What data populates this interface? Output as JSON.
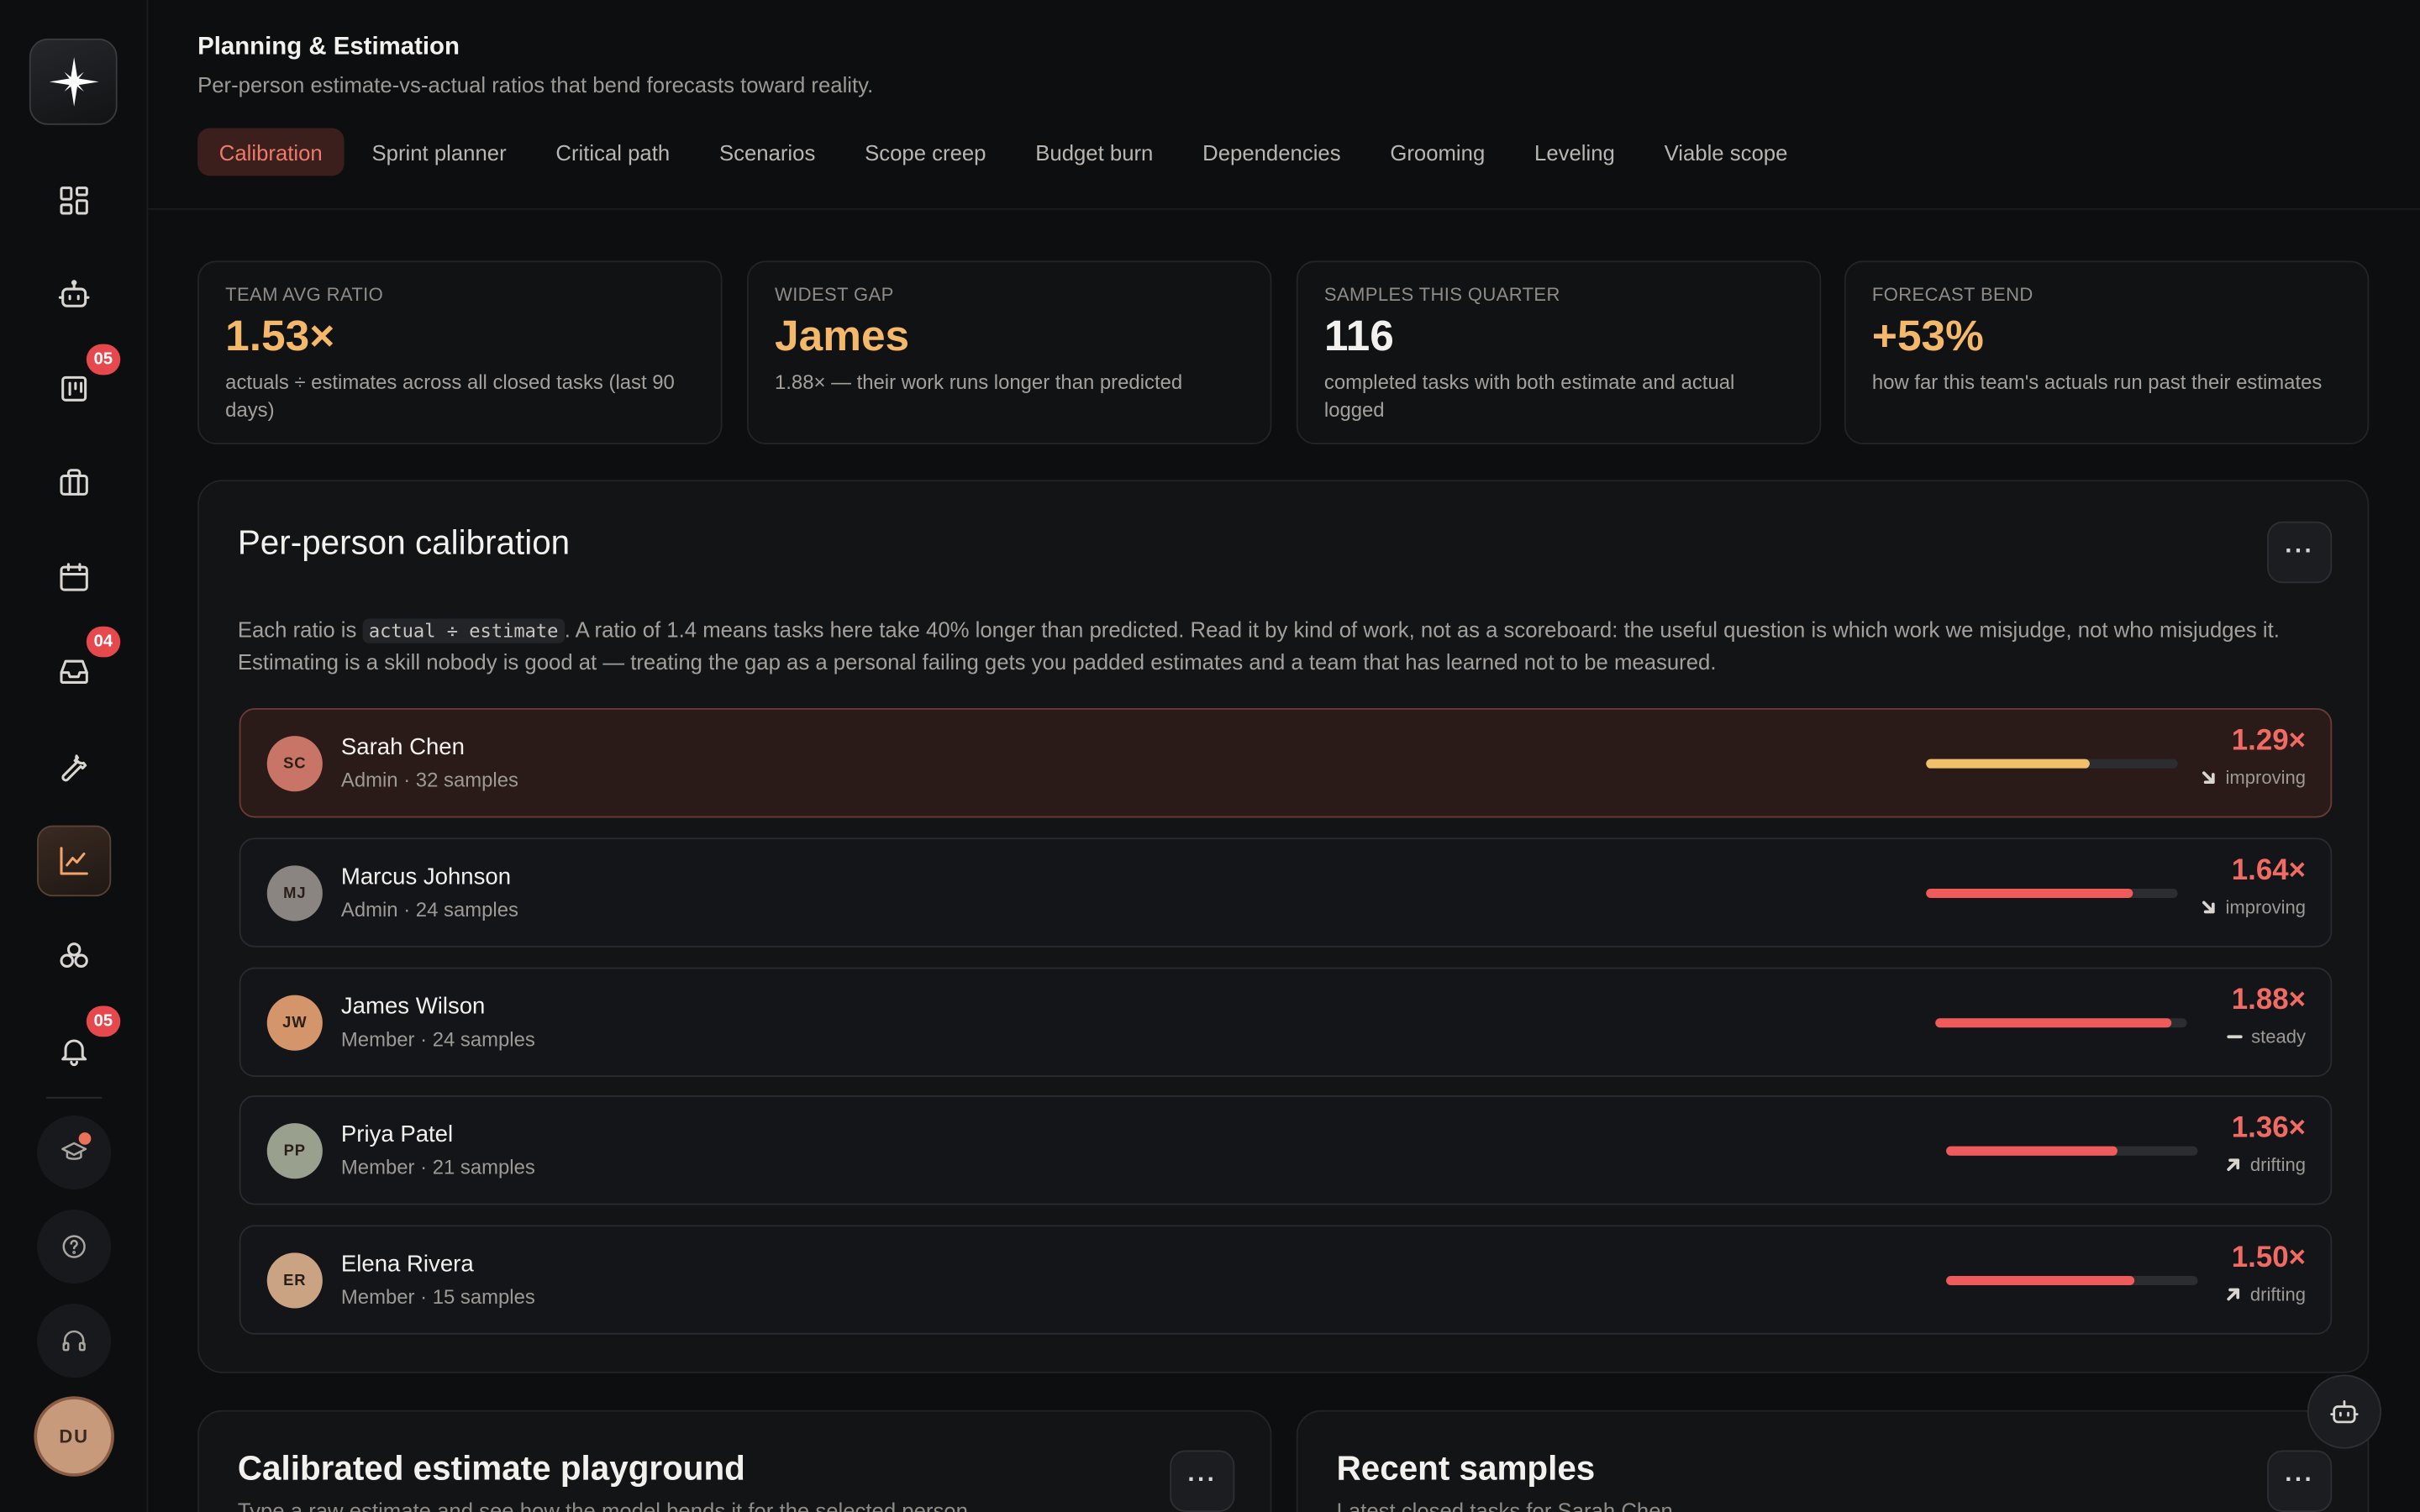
{
  "header": {
    "title": "Planning & Estimation",
    "subtitle": "Per-person estimate-vs-actual ratios that bend forecasts toward reality."
  },
  "tabs": [
    {
      "label": "Calibration",
      "active": true
    },
    {
      "label": "Sprint planner"
    },
    {
      "label": "Critical path"
    },
    {
      "label": "Scenarios"
    },
    {
      "label": "Scope creep"
    },
    {
      "label": "Budget burn"
    },
    {
      "label": "Dependencies"
    },
    {
      "label": "Grooming"
    },
    {
      "label": "Leveling"
    },
    {
      "label": "Viable scope"
    }
  ],
  "sidebar": {
    "items": [
      {
        "icon": "dashboard-icon"
      },
      {
        "icon": "bot-icon"
      },
      {
        "icon": "kanban-icon",
        "badge": "05"
      },
      {
        "icon": "briefcase-icon"
      },
      {
        "icon": "calendar-icon"
      },
      {
        "icon": "inbox-icon",
        "badge": "04"
      },
      {
        "icon": "wrench-icon"
      },
      {
        "icon": "chart-icon",
        "active": true
      },
      {
        "icon": "modules-icon"
      },
      {
        "icon": "bell-icon",
        "badge": "05"
      }
    ],
    "user_initials": "DU"
  },
  "kpis": [
    {
      "label": "TEAM AVG RATIO",
      "value": "1.53×",
      "desc": "actuals ÷ estimates across all closed tasks (last 90 days)",
      "accent": "#f4b86a"
    },
    {
      "label": "WIDEST GAP",
      "value": "James",
      "desc": "1.88× — their work runs longer than predicted",
      "accent": "#f4b86a"
    },
    {
      "label": "SAMPLES THIS QUARTER",
      "value": "116",
      "desc": "completed tasks with both estimate and actual logged",
      "accent": "#f3f1ee"
    },
    {
      "label": "FORECAST BEND",
      "value": "+53%",
      "desc": "how far this team's actuals run past their estimates",
      "accent": "#f4b86a"
    }
  ],
  "calibration": {
    "title": "Per-person calibration",
    "desc_pre": "Each ratio is ",
    "desc_code": "actual ÷ estimate",
    "desc_post": ". A ratio of 1.4 means tasks here take 40% longer than predicted. Read it by kind of work, not as a scoreboard: the useful question is which work we misjudge, not who misjudges it. Estimating is a skill nobody is good at — treating the gap as a personal failing gets you padded estimates and a team that has learned not to be measured.",
    "people": [
      {
        "initials": "SC",
        "name": "Sarah Chen",
        "meta": "Admin · 32 samples",
        "ratio": "1.29×",
        "trend": "improving",
        "trend_dir": "down",
        "fill": 0.65,
        "bar_color": "#f0c06a",
        "avatar_color": "#c87466",
        "highlight": true
      },
      {
        "initials": "MJ",
        "name": "Marcus Johnson",
        "meta": "Admin · 24 samples",
        "ratio": "1.64×",
        "trend": "improving",
        "trend_dir": "down",
        "fill": 0.82,
        "bar_color": "#ef5b5b",
        "avatar_color": "#8a8580"
      },
      {
        "initials": "JW",
        "name": "James Wilson",
        "meta": "Member · 24 samples",
        "ratio": "1.88×",
        "trend": "steady",
        "trend_dir": "flat",
        "fill": 0.94,
        "bar_color": "#ef5b5b",
        "avatar_color": "#d4956a"
      },
      {
        "initials": "PP",
        "name": "Priya Patel",
        "meta": "Member · 21 samples",
        "ratio": "1.36×",
        "trend": "drifting",
        "trend_dir": "up",
        "fill": 0.68,
        "bar_color": "#ef5b5b",
        "avatar_color": "#9aa08e"
      },
      {
        "initials": "ER",
        "name": "Elena Rivera",
        "meta": "Member · 15 samples",
        "ratio": "1.50×",
        "trend": "drifting",
        "trend_dir": "up",
        "fill": 0.75,
        "bar_color": "#ef5b5b",
        "avatar_color": "#c9a382"
      }
    ]
  },
  "playground": {
    "title": "Calibrated estimate playground",
    "subtitle": "Type a raw estimate and see how the model bends it for the selected person."
  },
  "recent": {
    "title": "Recent samples",
    "subtitle": "Latest closed tasks for Sarah Chen"
  }
}
